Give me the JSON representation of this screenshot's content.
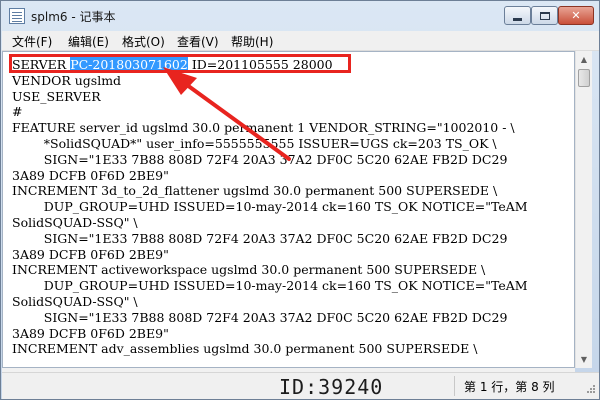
{
  "window": {
    "title": "splm6 - 记事本",
    "controls": {
      "minimize": "minimize",
      "maximize": "maximize",
      "close": "✕"
    }
  },
  "menu": [
    "文件(F)",
    "编辑(E)",
    "格式(O)",
    "查看(V)",
    "帮助(H)"
  ],
  "editor": {
    "lines": [
      [
        "SERVER ",
        "PC-201803071602",
        " ID=201105555 28000"
      ],
      "VENDOR ugslmd",
      "USE_SERVER",
      "#",
      "FEATURE server_id ugslmd 30.0 permanent 1 VENDOR_STRING=\"1002010 - \\",
      "        *SolidSQUAD*\" user_info=5555555555 ISSUER=UGS ck=203 TS_OK \\",
      "        SIGN=\"1E33 7B88 808D 72F4 20A3 37A2 DF0C 5C20 62AE FB2D DC29",
      "3A89 DCFB 0F6D 2BE9\"",
      "INCREMENT 3d_to_2d_flattener ugslmd 30.0 permanent 500 SUPERSEDE \\",
      "        DUP_GROUP=UHD ISSUED=10-may-2014 ck=160 TS_OK NOTICE=\"TeAM",
      "SolidSQUAD-SSQ\" \\",
      "        SIGN=\"1E33 7B88 808D 72F4 20A3 37A2 DF0C 5C20 62AE FB2D DC29",
      "3A89 DCFB 0F6D 2BE9\"",
      "INCREMENT activeworkspace ugslmd 30.0 permanent 500 SUPERSEDE \\",
      "        DUP_GROUP=UHD ISSUED=10-may-2014 ck=160 TS_OK NOTICE=\"TeAM",
      "SolidSQUAD-SSQ\" \\",
      "        SIGN=\"1E33 7B88 808D 72F4 20A3 37A2 DF0C 5C20 62AE FB2D DC29",
      "3A89 DCFB 0F6D 2BE9\"",
      "INCREMENT adv_assemblies ugslmd 30.0 permanent 500 SUPERSEDE \\"
    ],
    "selected_text": "PC-201803071602"
  },
  "status": {
    "position": "第 1 行，第 8 列"
  },
  "watermark": "ID:39240",
  "colors": {
    "selection": "#3399ff",
    "annotation": "#e8241f"
  },
  "icons": [
    "notepad-app-icon",
    "arrow-annotation-icon",
    "resize-grip-icon"
  ]
}
